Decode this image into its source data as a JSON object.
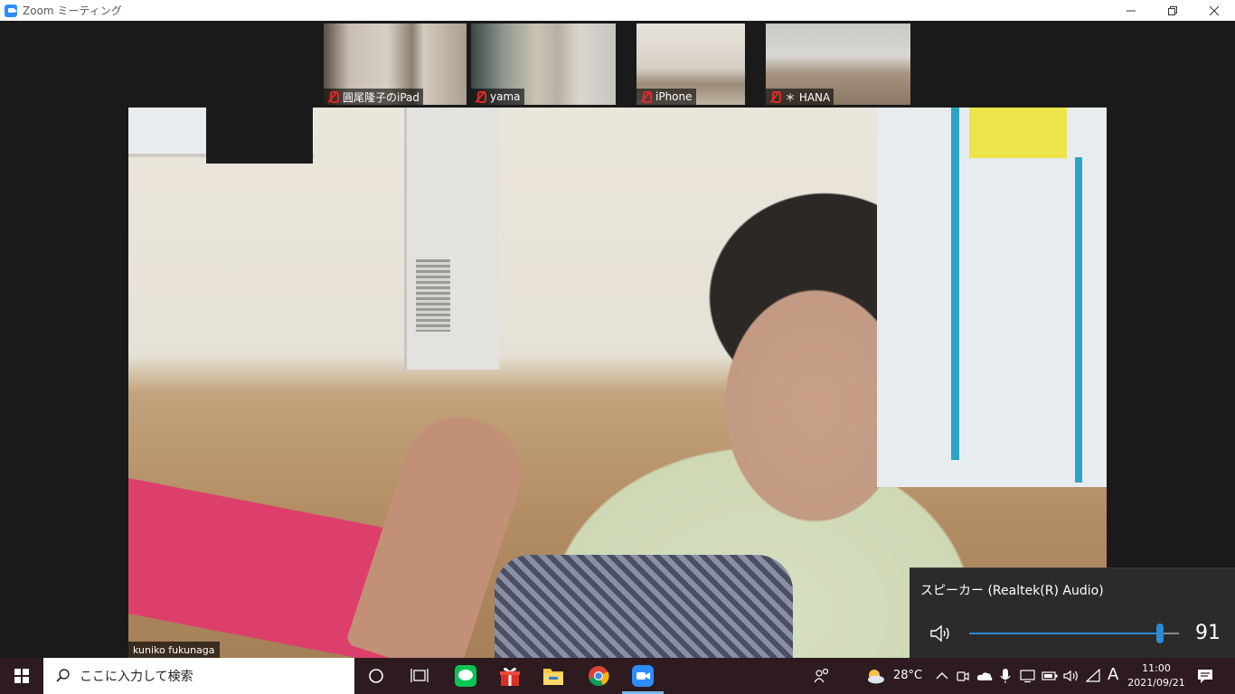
{
  "window": {
    "title": "Zoom ミーティング",
    "minimize_icon": "minimize-icon",
    "restore_icon": "restore-icon",
    "close_icon": "close-icon"
  },
  "participants": [
    {
      "name": "圓尾隆子のiPad",
      "muted": true
    },
    {
      "name": "yama",
      "muted": true
    },
    {
      "name": "iPhone",
      "muted": true
    },
    {
      "name": "＊ HANA",
      "muted": true
    }
  ],
  "active_speaker": {
    "name": "kuniko fukunaga"
  },
  "volume_flyout": {
    "device": "スピーカー (Realtek(R) Audio)",
    "level": 91,
    "level_label": "91"
  },
  "taskbar": {
    "search_placeholder": "ここに入力して検索",
    "apps": [
      "cortana-icon",
      "task-view-icon",
      "line-icon",
      "gift-icon",
      "file-explorer-icon",
      "chrome-icon",
      "zoom-icon"
    ],
    "active_app": "zoom-icon",
    "weather": "28°C",
    "ime": "A",
    "time": "11:00",
    "date": "2021/09/21"
  },
  "colors": {
    "zoom_blue": "#2d8cff",
    "taskbar_bg": "#2d1b1f",
    "mute_red": "#e02828",
    "accent": "#2a8ad4"
  }
}
